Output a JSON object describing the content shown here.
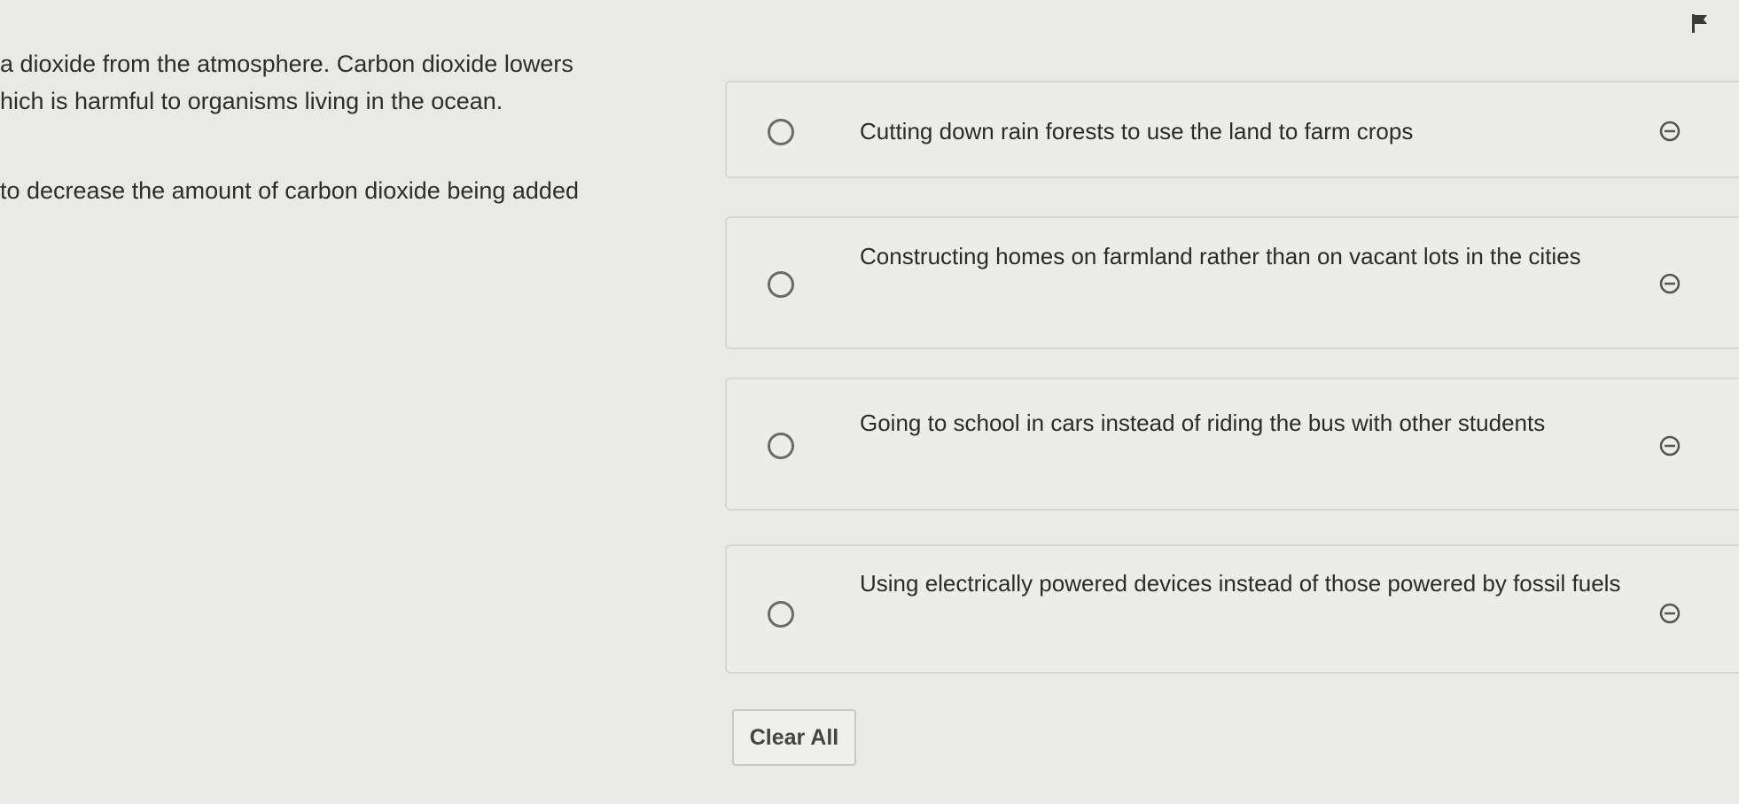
{
  "passage": {
    "lines": [
      "a dioxide from the atmosphere.  Carbon dioxide lowers",
      "hich is harmful to organisms living in the ocean.",
      "to decrease the amount of carbon dioxide being added"
    ]
  },
  "options": [
    {
      "text": "Cutting down rain forests to use the land to farm crops"
    },
    {
      "text": "Constructing homes on farmland rather than on vacant lots in the cities"
    },
    {
      "text": "Going to school in cars instead of riding the bus with other students"
    },
    {
      "text": "Using electrically powered devices instead of those powered by fossil fuels"
    }
  ],
  "clear_all_label": "Clear All",
  "icons": {
    "flag": "flag-icon",
    "eliminate": "eliminate-choice-icon",
    "radio": "radio-button-icon"
  }
}
